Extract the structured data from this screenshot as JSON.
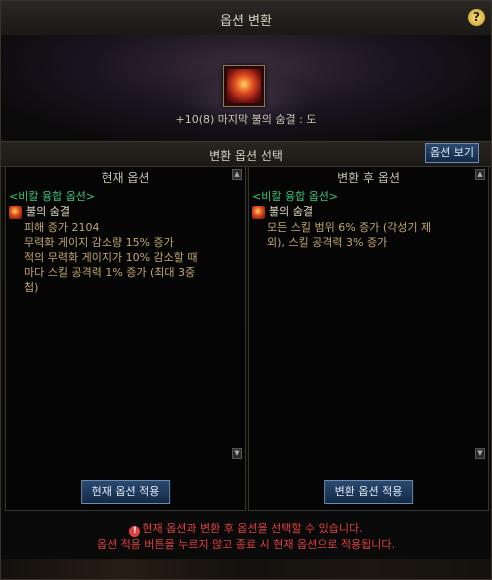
{
  "window": {
    "title": "옵션 변환",
    "help_label": "?"
  },
  "item": {
    "name": "+10(8) 마지막 불의 숨결 : 도"
  },
  "section": {
    "title": "변환 옵션 선택",
    "view_button": "옵션 보기"
  },
  "current": {
    "header": "현재 옵션",
    "group": "<비칼 융합 옵션>",
    "skill_name": "불의 숨결",
    "lines": [
      "피해 증가 2104",
      "무력화 게이지 감소량 15% 증가",
      "적의 무력화 게이지가 10% 감소할 때",
      "마다 스킬 공격력 1% 증가 (최대 3중",
      "첩)"
    ],
    "apply_button": "현재 옵션 적용"
  },
  "after": {
    "header": "변환 후 옵션",
    "group": "<비칼 융합 옵션>",
    "skill_name": "불의 숨결",
    "lines": [
      "모든 스킬 범위 6% 증가 (각성기 제",
      "외), 스킬 공격력 3% 증가"
    ],
    "apply_button": "변환 옵션 적용"
  },
  "notice": {
    "icon_label": "!",
    "line1": "현재 옵션과 변환 후 옵션을 선택할 수 있습니다.",
    "line2": "옵션 적용 버튼을 누르지 않고 종료 시 현재 옵션으로 적용됩니다."
  },
  "icons": {
    "skill": "fire-breath-icon",
    "warning": "warning-icon",
    "help": "help-icon"
  }
}
